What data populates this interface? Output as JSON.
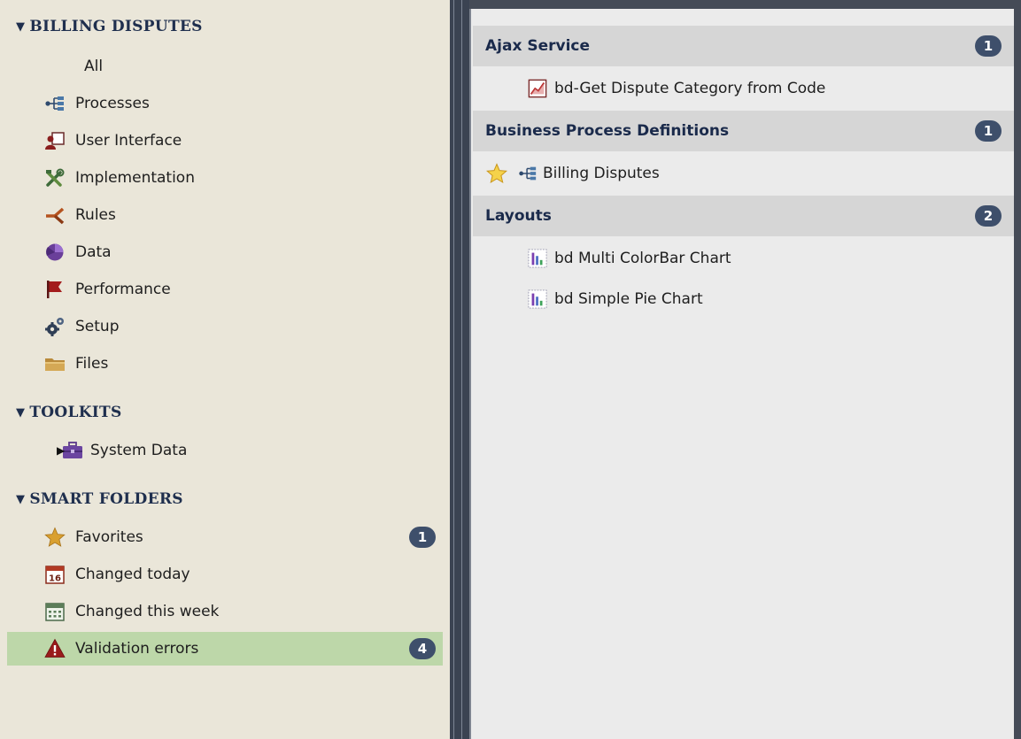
{
  "sidebar": {
    "sections": [
      {
        "title": "BILLING DISPUTES",
        "items": [
          {
            "label": "All",
            "icon": "none"
          },
          {
            "label": "Processes",
            "icon": "process-icon"
          },
          {
            "label": "User Interface",
            "icon": "user-interface-icon"
          },
          {
            "label": "Implementation",
            "icon": "implementation-tools-icon"
          },
          {
            "label": "Rules",
            "icon": "rules-icon"
          },
          {
            "label": "Data",
            "icon": "data-icon"
          },
          {
            "label": "Performance",
            "icon": "performance-flag-icon"
          },
          {
            "label": "Setup",
            "icon": "setup-gears-icon"
          },
          {
            "label": "Files",
            "icon": "folder-icon"
          }
        ]
      },
      {
        "title": "TOOLKITS",
        "items": [
          {
            "label": "System Data",
            "icon": "toolkit-briefcase-icon",
            "expander": "collapsed"
          }
        ]
      },
      {
        "title": "SMART FOLDERS",
        "items": [
          {
            "label": "Favorites",
            "icon": "star-icon",
            "badge": "1"
          },
          {
            "label": "Changed today",
            "icon": "calendar-day-icon",
            "calendar_number": "16"
          },
          {
            "label": "Changed this week",
            "icon": "calendar-week-icon"
          },
          {
            "label": "Validation errors",
            "icon": "warning-icon",
            "badge": "4",
            "selected": true
          }
        ]
      }
    ]
  },
  "panel": {
    "groups": [
      {
        "title": "Ajax Service",
        "count": "1",
        "items": [
          {
            "label": "bd-Get Dispute Category from Code",
            "icon": "ajax-service-icon"
          }
        ]
      },
      {
        "title": "Business Process Definitions",
        "count": "1",
        "items": [
          {
            "label": "Billing Disputes",
            "icon": "process-icon",
            "favorite": true
          }
        ]
      },
      {
        "title": "Layouts",
        "count": "2",
        "items": [
          {
            "label": "bd Multi ColorBar Chart",
            "icon": "layout-chart-icon"
          },
          {
            "label": "bd Simple Pie Chart",
            "icon": "layout-chart-icon"
          }
        ]
      }
    ]
  },
  "colors": {
    "sidebar_bg": "#eae6d9",
    "selected_bg": "#bdd7a9",
    "badge_bg": "#3e4f6b",
    "section_title": "#1f2f4e",
    "panel_bg": "#ebebeb",
    "group_header_bg": "#d6d6d6",
    "divider": "#3b4352"
  }
}
